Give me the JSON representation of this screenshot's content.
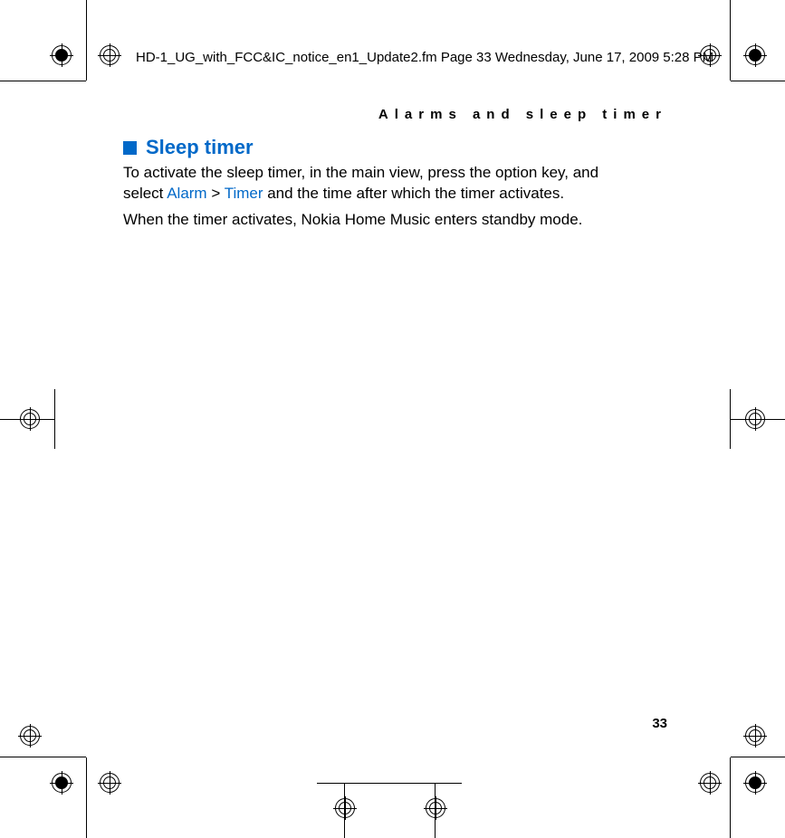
{
  "header": {
    "file_info": "HD-1_UG_with_FCC&IC_notice_en1_Update2.fm  Page 33  Wednesday, June 17, 2009  5:28 PM"
  },
  "section": {
    "running_head": "Alarms and sleep timer"
  },
  "content": {
    "heading": "Sleep timer",
    "para1_a": "To activate the sleep timer, in the main view, press the option key, and select ",
    "menu1": "Alarm",
    "sep": " > ",
    "menu2": "Timer",
    "para1_b": " and the time after which the timer activates.",
    "para2": "When the timer activates, Nokia Home Music enters standby mode."
  },
  "page": {
    "number": "33"
  }
}
